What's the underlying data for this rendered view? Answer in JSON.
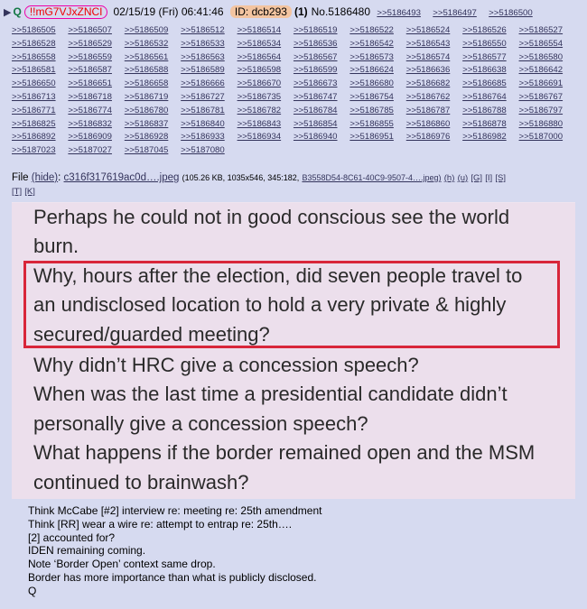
{
  "header": {
    "arrow": "▶",
    "q": "Q",
    "tripcode": "!!mG7VJxZNCI",
    "datetime": "02/15/19 (Fri) 06:41:46",
    "id_label": "ID: dcb293",
    "count": "(1)",
    "post_no": "No.5186480",
    "first_refs": [
      ">>5186493",
      ">>5186497",
      ">>5186500"
    ]
  },
  "refs": [
    ">>5186505",
    ">>5186507",
    ">>5186509",
    ">>5186512",
    ">>5186514",
    ">>5186519",
    ">>5186522",
    ">>5186524",
    ">>5186526",
    ">>5186527",
    ">>5186528",
    ">>5186529",
    ">>5186532",
    ">>5186533",
    ">>5186534",
    ">>5186536",
    ">>5186542",
    ">>5186543",
    ">>5186550",
    ">>5186554",
    ">>5186558",
    ">>5186559",
    ">>5186561",
    ">>5186563",
    ">>5186564",
    ">>5186567",
    ">>5186573",
    ">>5186574",
    ">>5186577",
    ">>5186580",
    ">>5186581",
    ">>5186587",
    ">>5186588",
    ">>5186589",
    ">>5186598",
    ">>5186599",
    ">>5186624",
    ">>5186636",
    ">>5186638",
    ">>5186642",
    ">>5186650",
    ">>5186651",
    ">>5186658",
    ">>5186666",
    ">>5186670",
    ">>5186673",
    ">>5186680",
    ">>5186682",
    ">>5186685",
    ">>5186691",
    ">>5186713",
    ">>5186718",
    ">>5186719",
    ">>5186727",
    ">>5186735",
    ">>5186747",
    ">>5186754",
    ">>5186762",
    ">>5186764",
    ">>5186767",
    ">>5186771",
    ">>5186774",
    ">>5186780",
    ">>5186781",
    ">>5186782",
    ">>5186784",
    ">>5186785",
    ">>5186787",
    ">>5186788",
    ">>5186797",
    ">>5186825",
    ">>5186832",
    ">>5186837",
    ">>5186840",
    ">>5186843",
    ">>5186854",
    ">>5186855",
    ">>5186860",
    ">>5186878",
    ">>5186880",
    ">>5186892",
    ">>5186909",
    ">>5186928",
    ">>5186933",
    ">>5186934",
    ">>5186940",
    ">>5186951",
    ">>5186976",
    ">>5186982",
    ">>5187000",
    ">>5187023",
    ">>5187027",
    ">>5187045",
    ">>5187080"
  ],
  "file": {
    "label": "File",
    "hide": "(hide)",
    "name": "c316f317619ac0d….jpeg",
    "meta": "(105.26 KB, 1035x546, 345:182,",
    "orig": "B3558D54-8C61-40C9-9507-4….jpeg)",
    "tools": [
      "(h)",
      "(u)",
      "[G]",
      "[I]",
      "[S]",
      "[T]",
      "[K]"
    ]
  },
  "image_text": {
    "lines": [
      "Perhaps he could not in good conscious see the world",
      "burn.",
      "Why, hours after the election, did seven people travel to",
      "an undisclosed location to hold a very private & highly",
      "secured/guarded meeting?",
      "Why didn’t HRC give a concession speech?",
      "When was the last time a presidential candidate didn’t",
      "personally give a concession speech?",
      "What happens if the border remained open and the MSM",
      "continued to brainwash?"
    ]
  },
  "body": {
    "lines": [
      "Think McCabe [#2] interview re: meeting re: 25th amendment",
      "Think [RR] wear a wire re: attempt to entrap re: 25th….",
      "[2] accounted for?",
      "IDEN remaining coming.",
      "Note ‘Border Open’ context same drop.",
      "Border has more importance than what is publicly disclosed.",
      "Q"
    ]
  },
  "colors": {
    "background": "#d6daf0",
    "panel": "#ecdfec",
    "highlight_box": "#d8263a",
    "link": "#34345c"
  }
}
